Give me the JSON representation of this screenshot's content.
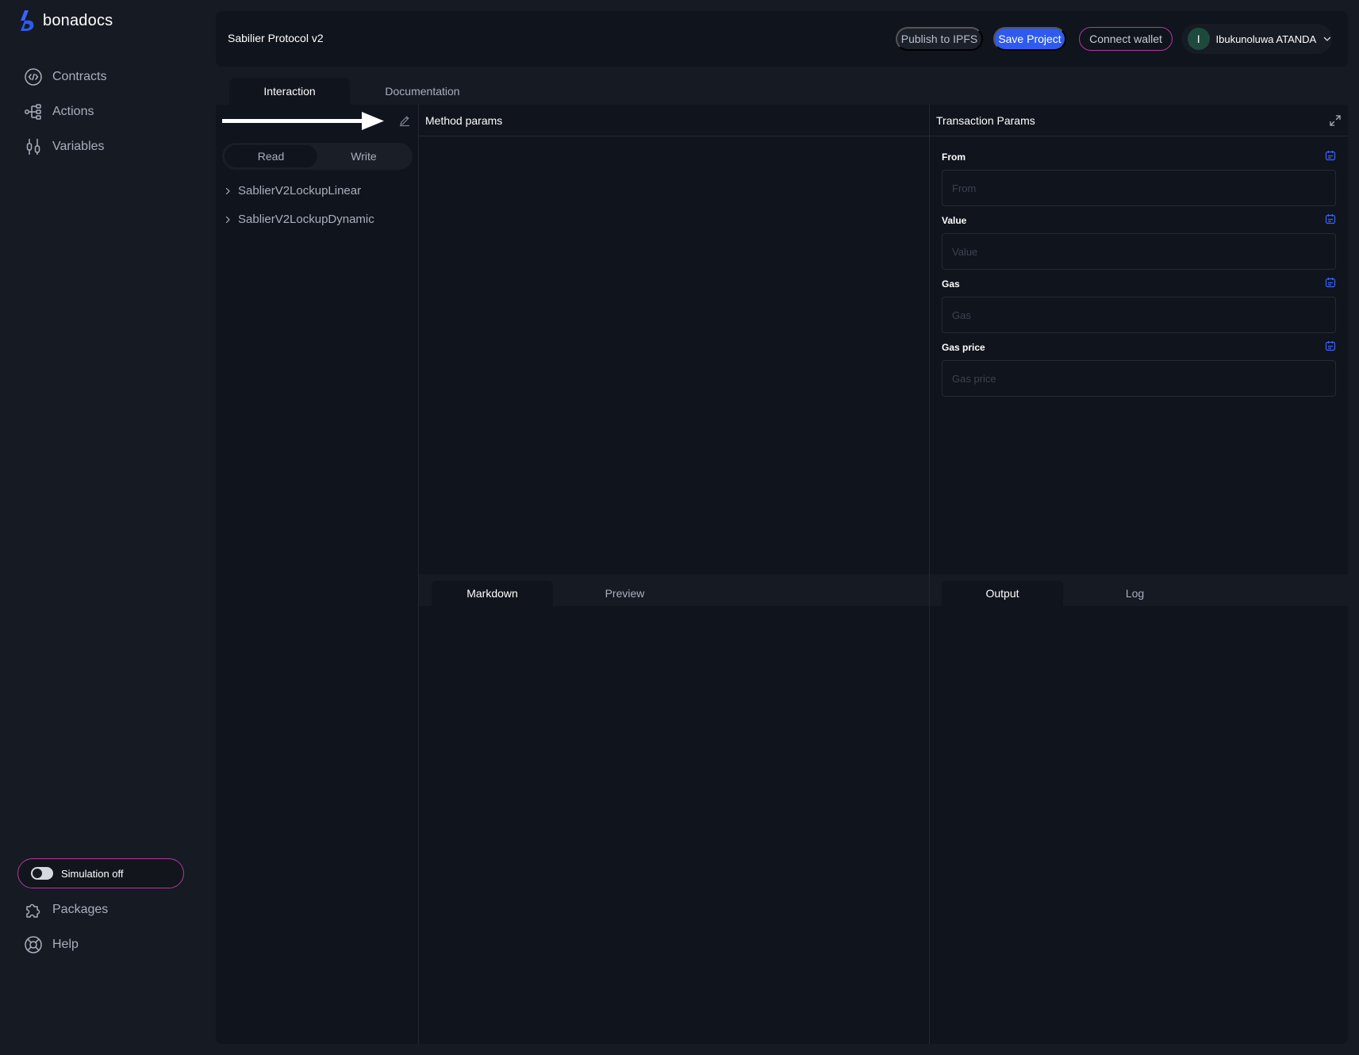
{
  "app": {
    "name": "bonadocs"
  },
  "sidebar": {
    "items": [
      {
        "label": "Contracts",
        "icon": "code-circle-icon"
      },
      {
        "label": "Actions",
        "icon": "flow-icon"
      },
      {
        "label": "Variables",
        "icon": "sliders-icon"
      }
    ],
    "simulation_label": "Simulation off",
    "bottom_items": [
      {
        "label": "Packages",
        "icon": "puzzle-icon"
      },
      {
        "label": "Help",
        "icon": "lifebuoy-icon"
      }
    ]
  },
  "header": {
    "project_title": "Sabilier Protocol v2",
    "publish_label": "Publish to IPFS",
    "save_label": "Save Project",
    "wallet_label": "Connect wallet",
    "user_initial": "I",
    "user_name": "Ibukunoluwa ATANDA"
  },
  "main_tabs": {
    "interaction": "Interaction",
    "documentation": "Documentation"
  },
  "left_panel": {
    "read_label": "Read",
    "write_label": "Write",
    "contracts": [
      "SablierV2LockupLinear",
      "SablierV2LockupDynamic"
    ]
  },
  "method_panel": {
    "title": "Method params"
  },
  "tx_panel": {
    "title": "Transaction Params",
    "fields": [
      {
        "label": "From",
        "placeholder": "From"
      },
      {
        "label": "Value",
        "placeholder": "Value"
      },
      {
        "label": "Gas",
        "placeholder": "Gas"
      },
      {
        "label": "Gas price",
        "placeholder": "Gas price"
      }
    ]
  },
  "bottom_tabs": {
    "markdown": "Markdown",
    "preview": "Preview",
    "output": "Output",
    "log": "Log"
  },
  "colors": {
    "accent": "#2e5af0",
    "wallet_border": "#b03aa0",
    "background": "#161a23",
    "panel": "#10141c"
  }
}
